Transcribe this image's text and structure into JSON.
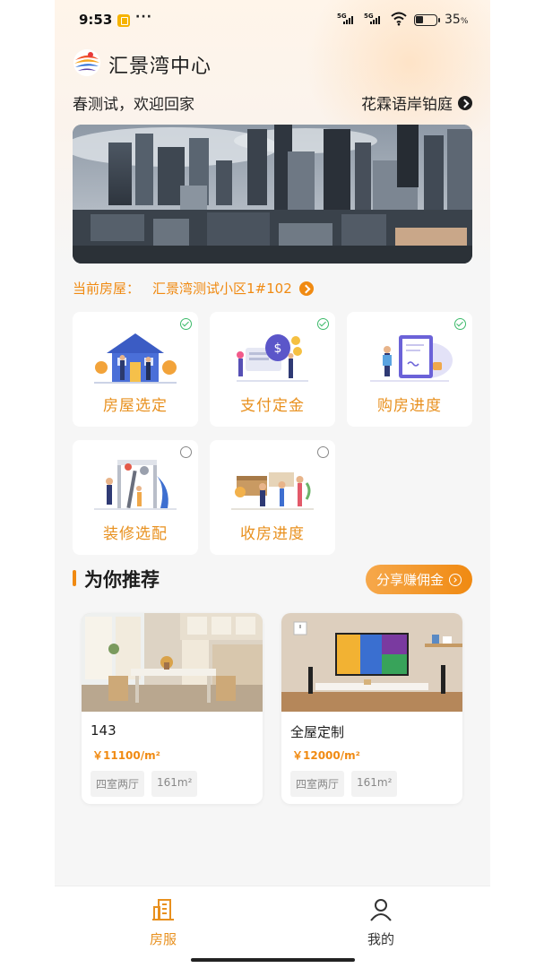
{
  "status_bar": {
    "time": "9:53",
    "dots": "···",
    "signal1": "5G",
    "signal2": "5G",
    "battery_pct": "35",
    "battery_unit": "%"
  },
  "header": {
    "app_title": "汇景湾中心",
    "welcome": "春测试，欢迎回家",
    "community": "花霖语岸铂庭"
  },
  "current_house": {
    "label": "当前房屋：",
    "value": "汇景湾测试小区1#102"
  },
  "services": [
    {
      "label": "房屋选定",
      "done": true,
      "icon": "house-selection-illustration"
    },
    {
      "label": "支付定金",
      "done": true,
      "icon": "payment-deposit-illustration"
    },
    {
      "label": "购房进度",
      "done": true,
      "icon": "purchase-progress-illustration"
    },
    {
      "label": "装修选配",
      "done": false,
      "icon": "decoration-illustration"
    },
    {
      "label": "收房进度",
      "done": false,
      "icon": "handover-progress-illustration"
    }
  ],
  "recommend": {
    "title": "为你推荐",
    "share_label": "分享赚佣金",
    "items": [
      {
        "name": "143",
        "price": "￥11100/m²",
        "tags": [
          "四室两厅",
          "161m²"
        ]
      },
      {
        "name": "全屋定制",
        "price": "￥12000/m²",
        "tags": [
          "四室两厅",
          "161m²"
        ]
      }
    ]
  },
  "tabbar": {
    "tabs": [
      {
        "label": "房服",
        "icon": "building-icon"
      },
      {
        "label": "我的",
        "icon": "user-icon"
      }
    ]
  },
  "colors": {
    "accent": "#f08a12",
    "label_orange": "#e8901e",
    "check_green": "#3cba6a"
  }
}
